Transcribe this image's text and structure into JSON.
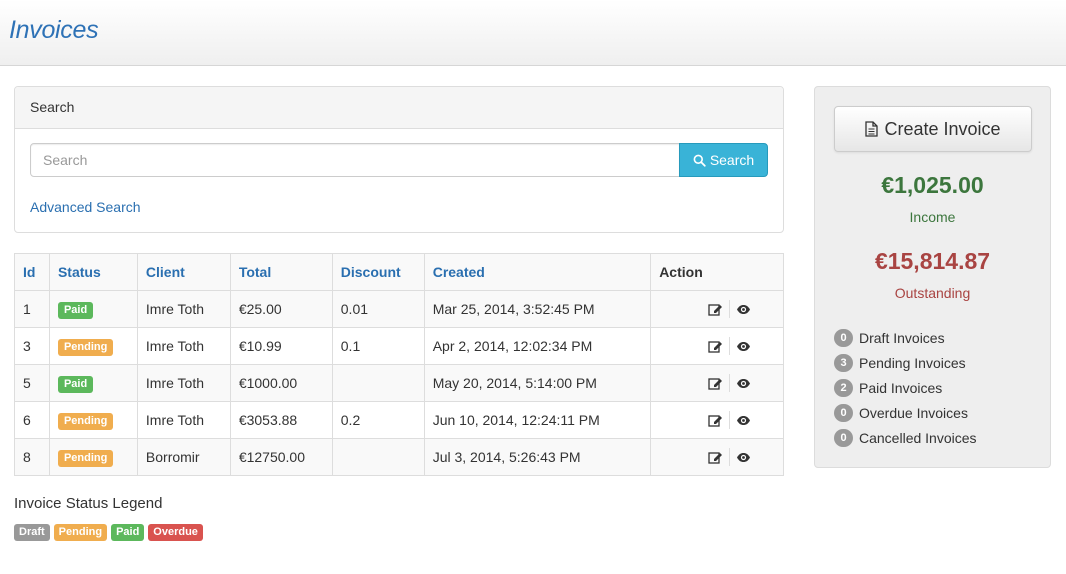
{
  "app": {
    "title": "Invoices"
  },
  "search": {
    "panel_title": "Search",
    "placeholder": "Search",
    "button_label": "Search",
    "advanced_link": "Advanced Search"
  },
  "table": {
    "columns": [
      "Id",
      "Status",
      "Client",
      "Total",
      "Discount",
      "Created",
      "Action"
    ],
    "rows": [
      {
        "id": "1",
        "status": "Paid",
        "client": "Imre Toth",
        "total": "€25.00",
        "discount": "0.01",
        "created": "Mar 25, 2014, 3:52:45 PM"
      },
      {
        "id": "3",
        "status": "Pending",
        "client": "Imre Toth",
        "total": "€10.99",
        "discount": "0.1",
        "created": "Apr 2, 2014, 12:02:34 PM"
      },
      {
        "id": "5",
        "status": "Paid",
        "client": "Imre Toth",
        "total": "€1000.00",
        "discount": "",
        "created": "May 20, 2014, 5:14:00 PM"
      },
      {
        "id": "6",
        "status": "Pending",
        "client": "Imre Toth",
        "total": "€3053.88",
        "discount": "0.2",
        "created": "Jun 10, 2014, 12:24:11 PM"
      },
      {
        "id": "8",
        "status": "Pending",
        "client": "Borromir",
        "total": "€12750.00",
        "discount": "",
        "created": "Jul 3, 2014, 5:26:43 PM"
      }
    ],
    "action_icons": [
      "edit-icon",
      "eye-icon"
    ]
  },
  "legend": {
    "title": "Invoice Status Legend",
    "items": [
      "Draft",
      "Pending",
      "Paid",
      "Overdue"
    ]
  },
  "sidebar": {
    "create_button": "Create Invoice",
    "income_amount": "€1,025.00",
    "income_label": "Income",
    "outstanding_amount": "€15,814.87",
    "outstanding_label": "Outstanding",
    "counts": [
      {
        "count": "0",
        "label": "Draft Invoices"
      },
      {
        "count": "3",
        "label": "Pending Invoices"
      },
      {
        "count": "2",
        "label": "Paid Invoices"
      },
      {
        "count": "0",
        "label": "Overdue Invoices"
      },
      {
        "count": "0",
        "label": "Cancelled Invoices"
      }
    ]
  },
  "colors": {
    "paid": "#5cb85c",
    "pending": "#f0ad4e",
    "draft": "#999999",
    "overdue": "#d9534f",
    "link": "#2a6fb0",
    "income": "#3c763d",
    "outstanding": "#a94442",
    "search_button": "#39b3d7"
  }
}
